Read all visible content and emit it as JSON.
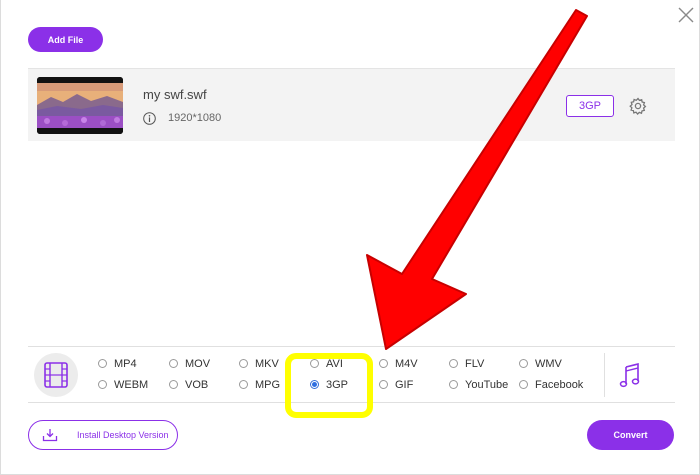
{
  "toolbar": {
    "add_file_label": "Add File"
  },
  "file": {
    "name": "my swf.swf",
    "resolution": "1920*1080",
    "selected_format": "3GP"
  },
  "formats": {
    "row1": [
      "MP4",
      "MOV",
      "MKV",
      "AVI",
      "M4V",
      "FLV",
      "WMV"
    ],
    "row2": [
      "WEBM",
      "VOB",
      "MPG",
      "3GP",
      "GIF",
      "YouTube",
      "Facebook"
    ],
    "selected": "3GP"
  },
  "footer": {
    "install_label": "Install Desktop Version",
    "convert_label": "Convert"
  },
  "icons": {
    "close": "close-icon",
    "info": "info-icon",
    "settings": "gear-icon",
    "video_tab": "film-icon",
    "audio_tab": "music-note-icon",
    "install": "download-icon"
  },
  "colors": {
    "accent": "#8b30e8",
    "annotation_arrow": "#ff0000",
    "annotation_highlight": "#ffff00"
  }
}
